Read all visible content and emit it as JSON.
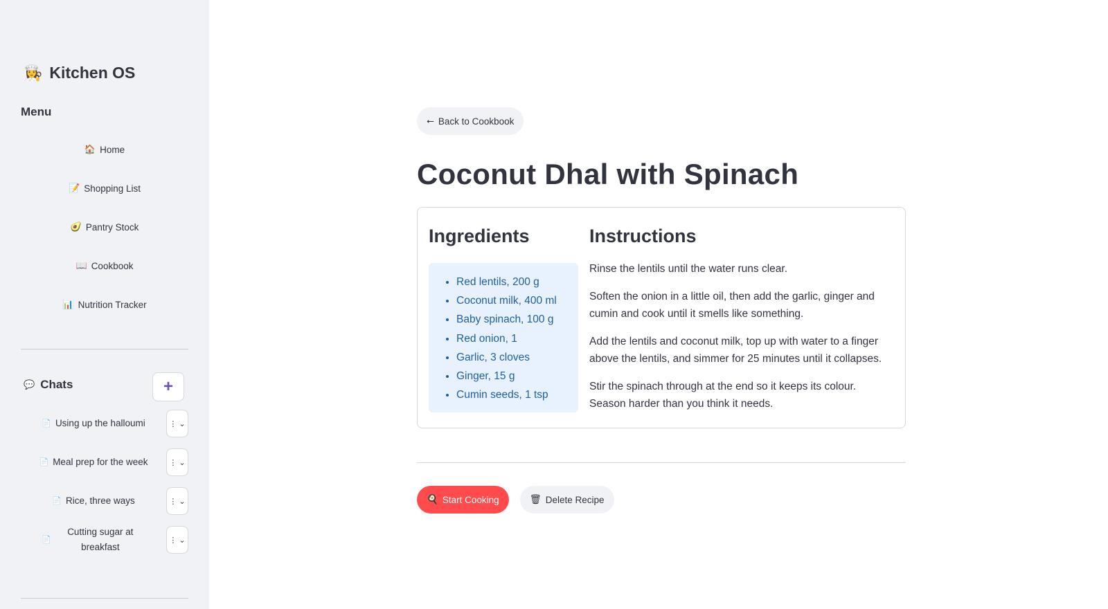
{
  "app": {
    "brand_icon": "👩‍🍳",
    "brand_name": "Kitchen OS"
  },
  "sidebar": {
    "menu_heading": "Menu",
    "nav_items": [
      {
        "icon": "🏠",
        "icon_name": "home-icon",
        "label": "Home"
      },
      {
        "icon": "📝",
        "icon_name": "shopping-list-icon",
        "label": "Shopping List"
      },
      {
        "icon": "🥑",
        "icon_name": "avocado-icon",
        "label": "Pantry Stock"
      },
      {
        "icon": "📖",
        "icon_name": "book-icon",
        "label": "Cookbook"
      },
      {
        "icon": "📊",
        "icon_name": "chart-icon",
        "label": "Nutrition Tracker"
      }
    ],
    "chats_icon": "💬",
    "chats_heading": "Chats",
    "add_chat_label": "+",
    "chats": [
      {
        "icon": "📄",
        "label": "Using up the halloumi",
        "menu": "⋮ ⌄"
      },
      {
        "icon": "📄",
        "label": "Meal prep for the week",
        "menu": "⋮ ⌄"
      },
      {
        "icon": "📄",
        "label": "Rice, three ways",
        "menu": "⋮ ⌄"
      },
      {
        "icon": "📄",
        "label": "Cutting sugar at breakfast",
        "menu": "⋮ ⌄"
      }
    ]
  },
  "main": {
    "back_icon": "⭠",
    "back_label": "Back to Cookbook",
    "title": "Coconut Dhal with Spinach",
    "ingredients_heading": "Ingredients",
    "ingredients": [
      "Red lentils, 200 g",
      "Coconut milk, 400 ml",
      "Baby spinach, 100 g",
      "Red onion, 1",
      "Garlic, 3 cloves",
      "Ginger, 15 g",
      "Cumin seeds, 1 tsp"
    ],
    "instructions_heading": "Instructions",
    "instructions": [
      "Rinse the lentils until the water runs clear.",
      "Soften the onion in a little oil, then add the garlic, ginger and cumin and cook until it smells like something.",
      "Add the lentils and coconut milk, top up with water to a finger above the lentils, and simmer for 25 minutes until it collapses.",
      "Stir the spinach through at the end so it keeps its colour. Season harder than you think it needs."
    ],
    "start_icon": "🍳",
    "start_label": "Start Cooking",
    "delete_icon": "🗑",
    "delete_label": "Delete Recipe"
  },
  "colors": {
    "sidebar_bg": "#f0f2f6",
    "primary": "#ff4b4b",
    "ingredient_bg": "#e8f2fe",
    "ingredient_text": "#1f5fa0",
    "text": "#31333f"
  }
}
